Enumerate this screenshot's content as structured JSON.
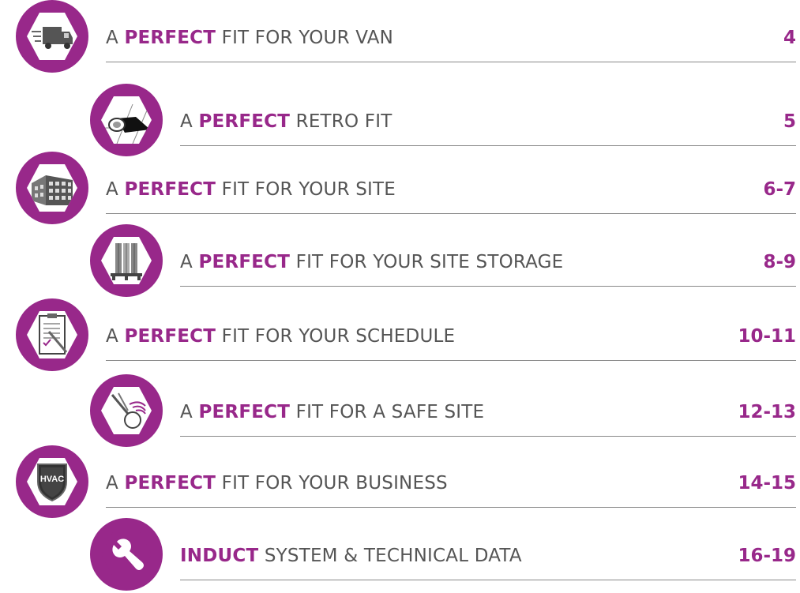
{
  "accent_color": "#98288a",
  "entries": [
    {
      "prefix": "A ",
      "highlight": "PERFECT",
      "rest": " FIT FOR YOUR VAN",
      "page": "4",
      "icon": "van-icon"
    },
    {
      "prefix": "A ",
      "highlight": "PERFECT",
      "rest": " RETRO FIT",
      "page": "5",
      "icon": "duct-icon"
    },
    {
      "prefix": "A ",
      "highlight": "PERFECT",
      "rest": " FIT FOR YOUR SITE",
      "page": "6-7",
      "icon": "building-icon"
    },
    {
      "prefix": "A ",
      "highlight": "PERFECT",
      "rest": " FIT FOR YOUR SITE STORAGE",
      "page": "8-9",
      "icon": "storage-icon"
    },
    {
      "prefix": "A ",
      "highlight": "PERFECT",
      "rest": " FIT FOR YOUR SCHEDULE",
      "page": "10-11",
      "icon": "clipboard-icon"
    },
    {
      "prefix": "A ",
      "highlight": "PERFECT",
      "rest": " FIT FOR A SAFE SITE",
      "page": "12-13",
      "icon": "safety-icon"
    },
    {
      "prefix": "A ",
      "highlight": "PERFECT",
      "rest": " FIT FOR YOUR BUSINESS",
      "page": "14-15",
      "icon": "hvac-shield-icon",
      "icon_text": "HVAC"
    },
    {
      "prefix": "",
      "highlight": "INDUCT",
      "rest": " SYSTEM & TECHNICAL DATA",
      "page": "16-19",
      "icon": "wrench-icon"
    }
  ]
}
